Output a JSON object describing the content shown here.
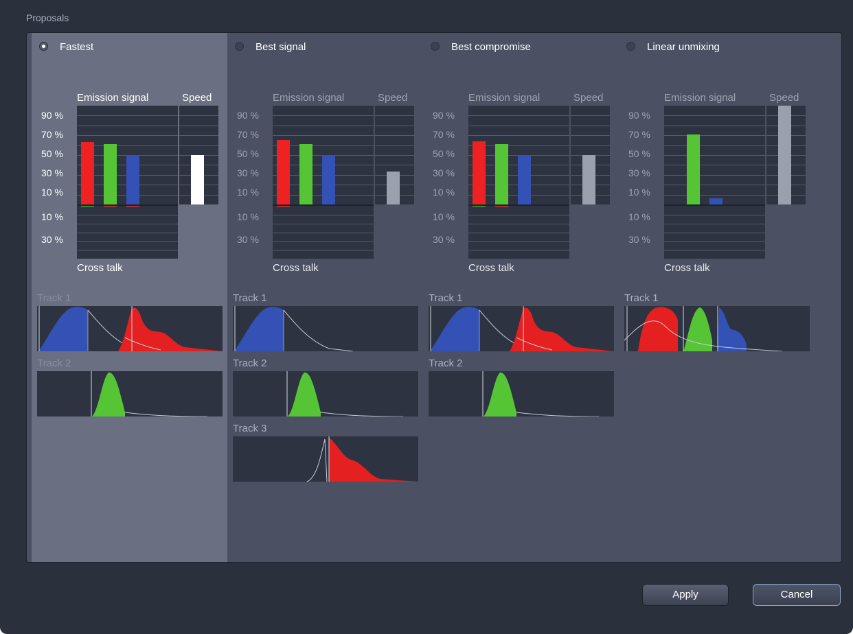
{
  "window": {
    "title": "Proposals"
  },
  "options": [
    {
      "label": "Fastest",
      "selected": true,
      "active": true,
      "emission": [
        {
          "color": "#ee2222",
          "value": 63
        },
        {
          "color": "#55c535",
          "value": 61
        },
        {
          "color": "#3451b6",
          "value": 50
        }
      ],
      "speed": {
        "color": "#ffffff",
        "value": 50
      },
      "crosstalk": [
        {
          "color": "#2d8a3a",
          "value": 1
        },
        {
          "color": "#a83030",
          "value": 1
        },
        {
          "color": "#a83030",
          "value": 1
        }
      ],
      "tracks": [
        {
          "label": "Track 1",
          "curves": [
            "blue-narrow",
            "red"
          ]
        },
        {
          "label": "Track 2",
          "curves": [
            "green"
          ]
        }
      ]
    },
    {
      "label": "Best signal",
      "selected": false,
      "active": false,
      "emission": [
        {
          "color": "#ee2222",
          "value": 65
        },
        {
          "color": "#55c535",
          "value": 61
        },
        {
          "color": "#3451b6",
          "value": 50
        }
      ],
      "speed": {
        "color": "#9aa0ad",
        "value": 33
      },
      "crosstalk": [
        {
          "color": "#a83030",
          "value": 1
        }
      ],
      "tracks": [
        {
          "label": "Track 1",
          "curves": [
            "blue-narrow"
          ]
        },
        {
          "label": "Track 2",
          "curves": [
            "green"
          ]
        },
        {
          "label": "Track 3",
          "curves": [
            "red-steep"
          ]
        }
      ]
    },
    {
      "label": "Best compromise",
      "selected": false,
      "active": false,
      "emission": [
        {
          "color": "#ee2222",
          "value": 64
        },
        {
          "color": "#55c535",
          "value": 61
        },
        {
          "color": "#3451b6",
          "value": 50
        }
      ],
      "speed": {
        "color": "#9aa0ad",
        "value": 50
      },
      "crosstalk": [
        {
          "color": "#2d8a3a",
          "value": 1
        },
        {
          "color": "#a83030",
          "value": 1
        }
      ],
      "tracks": [
        {
          "label": "Track 1",
          "curves": [
            "blue-narrow",
            "red"
          ]
        },
        {
          "label": "Track 2",
          "curves": [
            "green"
          ]
        }
      ]
    },
    {
      "label": "Linear unmixing",
      "selected": false,
      "active": false,
      "emission": [
        {
          "color": "#55c535",
          "value": 71
        },
        {
          "color": "#3451b6",
          "value": 6
        }
      ],
      "speed": {
        "color": "#9aa0ad",
        "value": 100
      },
      "crosstalk": [],
      "tracks": [
        {
          "label": "Track 1",
          "curves": [
            "unmix"
          ]
        }
      ]
    }
  ],
  "chart_labels": {
    "emission_header": "Emission signal",
    "speed_header": "Speed",
    "emission_ticks": [
      "90 %",
      "70 %",
      "50 %",
      "30 %",
      "10 %"
    ],
    "crosstalk_ticks": [
      "10 %",
      "30 %"
    ],
    "crosstalk_label": "Cross talk"
  },
  "colors": {
    "selected_panel": "#6a7081",
    "panel": "#4b5163",
    "plot_bg": "#2e3342",
    "red": "#ee2222",
    "green": "#55c535",
    "blue": "#3451b6"
  },
  "buttons": {
    "apply": "Apply",
    "cancel": "Cancel"
  }
}
